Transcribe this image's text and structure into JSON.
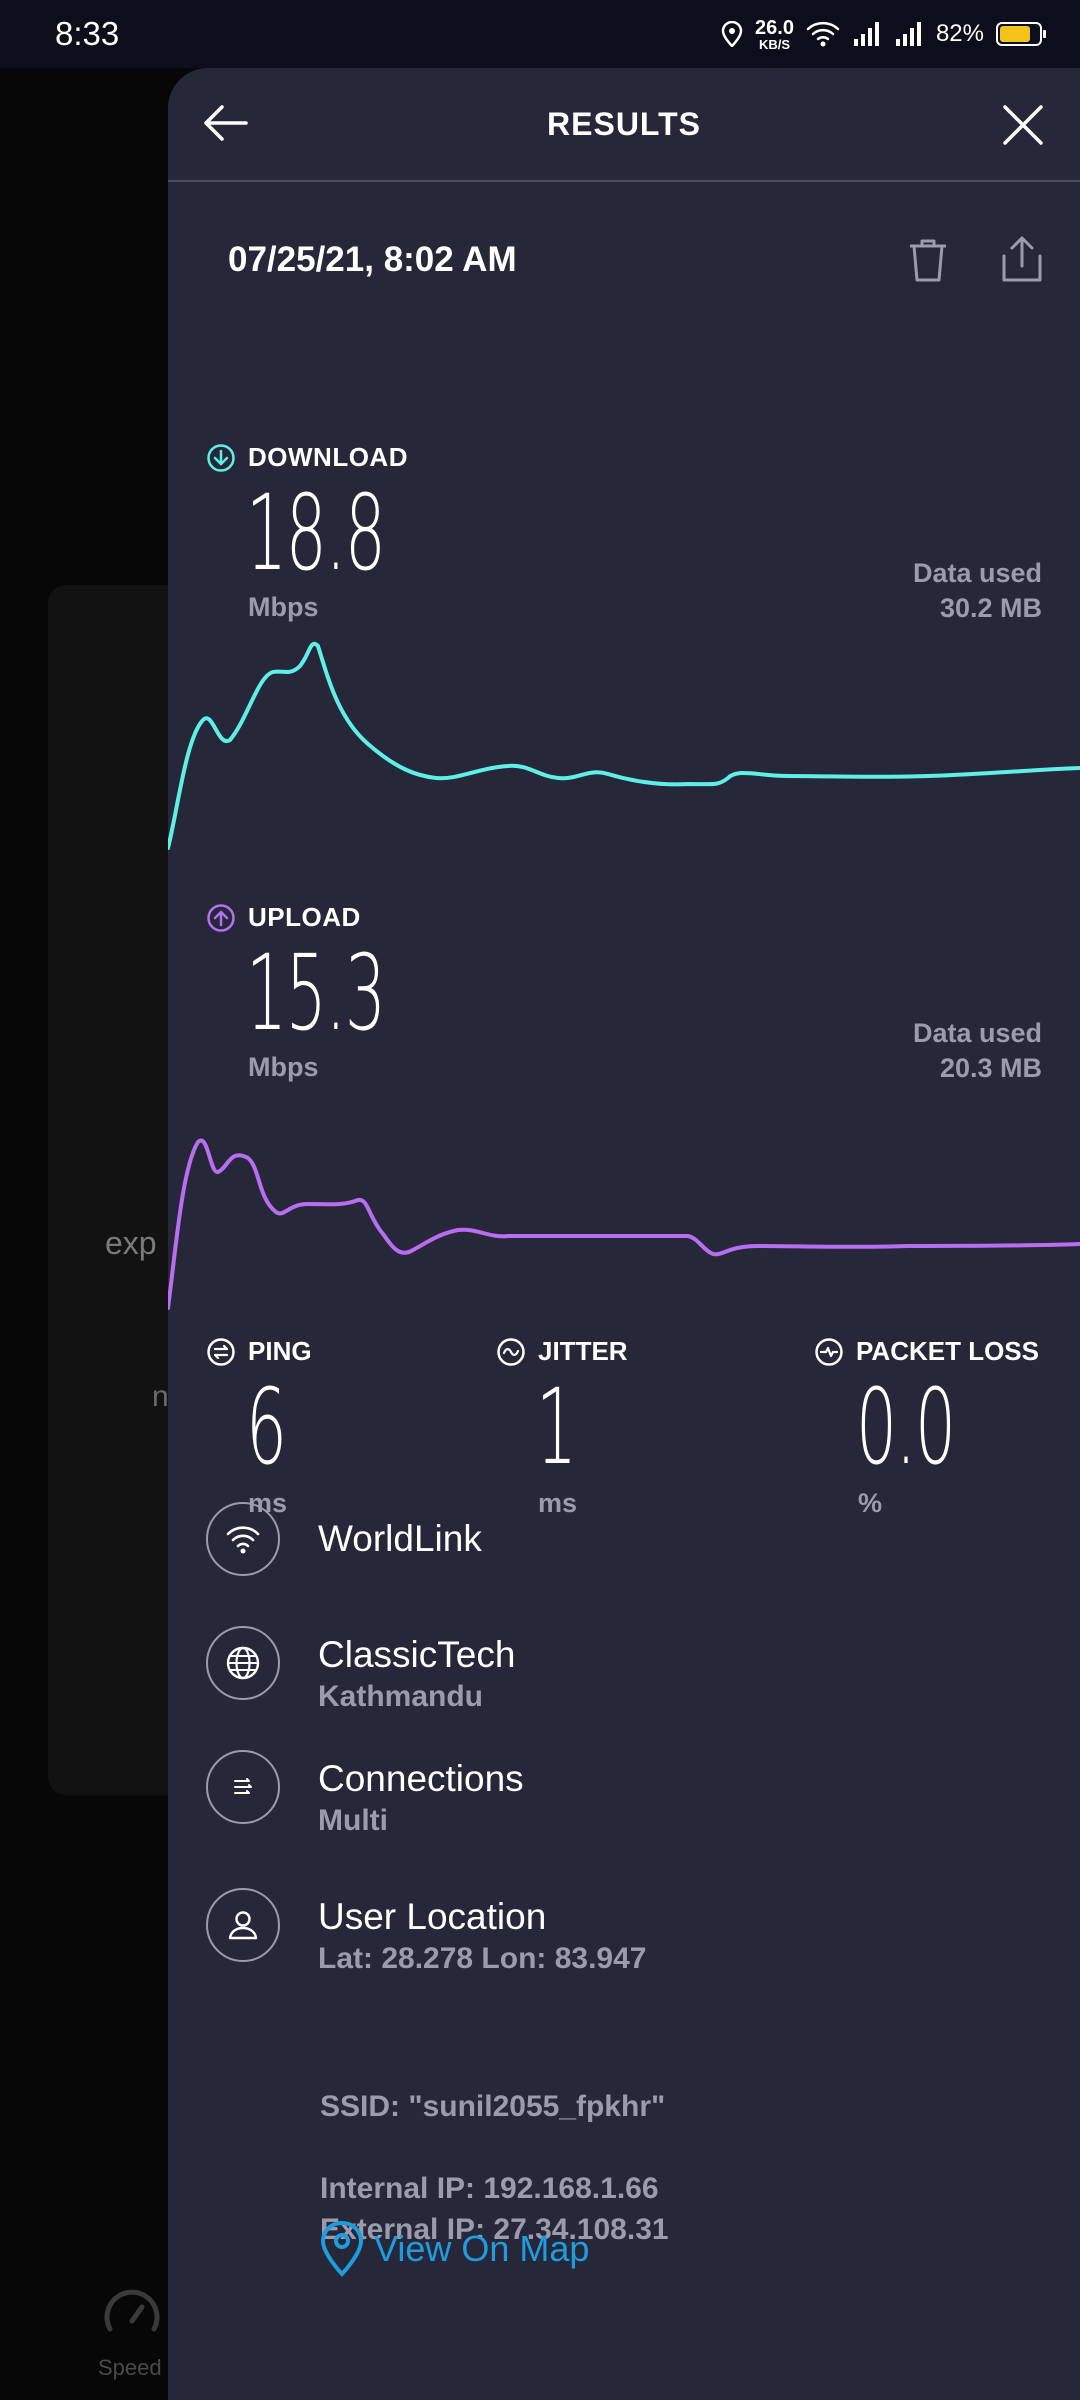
{
  "status_bar": {
    "time": "8:33",
    "net_speed_value": "26.0",
    "net_speed_unit": "KB/S",
    "battery": "82%",
    "battery_color": "#f4c21b"
  },
  "background": {
    "partial_text_1": "exp",
    "partial_text_2": "n",
    "nav_label": "Speed"
  },
  "header": {
    "title": "RESULTS"
  },
  "result": {
    "datetime": "07/25/21, 8:02 AM"
  },
  "download": {
    "label": "DOWNLOAD",
    "value": "18.8",
    "unit": "Mbps",
    "data_used_label": "Data used",
    "data_used_value": "30.2 MB",
    "color": "#5ef0e6"
  },
  "upload": {
    "label": "UPLOAD",
    "value": "15.3",
    "unit": "Mbps",
    "data_used_label": "Data used",
    "data_used_value": "20.3 MB",
    "color": "#b86ef0"
  },
  "metrics": {
    "ping": {
      "label": "PING",
      "value": "6",
      "unit": "ms"
    },
    "jitter": {
      "label": "JITTER",
      "value": "1",
      "unit": "ms"
    },
    "packet_loss": {
      "label": "PACKET LOSS",
      "value": "0.0",
      "unit": "%"
    }
  },
  "info": {
    "isp": {
      "title": "WorldLink"
    },
    "server": {
      "title": "ClassicTech",
      "sub": "Kathmandu"
    },
    "connections": {
      "title": "Connections",
      "sub": "Multi"
    },
    "location": {
      "title": "User Location",
      "sub": "Lat: 28.278 Lon: 83.947"
    }
  },
  "details": {
    "ssid": "SSID: \"sunil2055_fpkhr\"",
    "internal_ip": "Internal IP: 192.168.1.66",
    "external_ip": "External IP: 27.34.108.31"
  },
  "map_link": {
    "label": "View On Map",
    "color": "#1e9ce0"
  }
}
